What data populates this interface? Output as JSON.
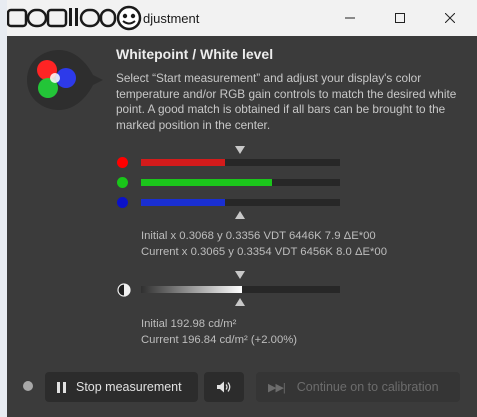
{
  "titlebar": {
    "title": "djustment",
    "logo_text": "mobile01",
    "minimize_icon": "minimize-icon",
    "maximize_icon": "maximize-icon",
    "close_icon": "close-icon"
  },
  "content": {
    "heading": "Whitepoint / White level",
    "description": "Select “Start measurement” and adjust your display's color temperature and/or RGB gain controls to match the desired white point. A good match is obtained if all bars can be brought to the marked position in the center."
  },
  "rgb_bars": [
    {
      "channel": "red",
      "color": "#ff0000",
      "fill_color": "#d41b1b",
      "level": 0.42
    },
    {
      "channel": "green",
      "color": "#19c619",
      "fill_color": "#1bc61b",
      "level": 0.66
    },
    {
      "channel": "blue",
      "color": "#0b12c9",
      "fill_color": "#1a2fd2",
      "level": 0.42
    }
  ],
  "whitepoint": {
    "initial": "Initial x 0.3068 y 0.3356 VDT 6446K 7.9 ΔE*00",
    "current": "Current x 0.3065 y 0.3354 VDT 6456K 8.0 ΔE*00"
  },
  "luminance_bar": {
    "level": 0.51,
    "icon": "half-circle-icon"
  },
  "luminance": {
    "initial": "Initial 192.98 cd/m²",
    "current": "Current 196.84 cd/m² (+2.00%)"
  },
  "footer": {
    "stop_label": "Stop measurement",
    "sound_icon": "speaker-icon",
    "continue_label": "Continue on to calibration"
  }
}
